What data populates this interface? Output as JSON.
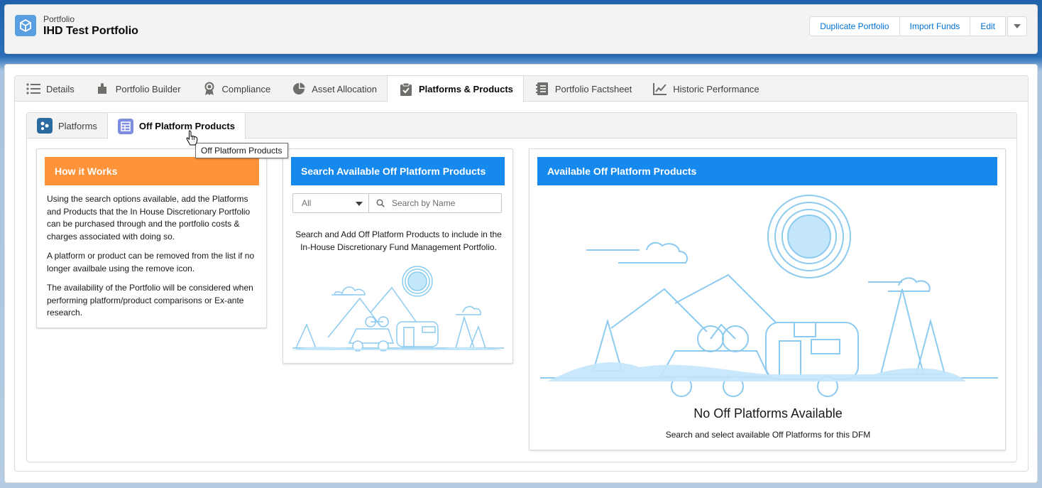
{
  "header": {
    "eyebrow": "Portfolio",
    "title": "IHD Test Portfolio",
    "buttons": [
      "Duplicate Portfolio",
      "Import Funds",
      "Edit"
    ]
  },
  "tabs": [
    {
      "label": "Details",
      "icon": "list-icon"
    },
    {
      "label": "Portfolio Builder",
      "icon": "puzzle-icon"
    },
    {
      "label": "Compliance",
      "icon": "ribbon-icon"
    },
    {
      "label": "Asset Allocation",
      "icon": "pie-chart-icon"
    },
    {
      "label": "Platforms & Products",
      "icon": "clipboard-check-icon"
    },
    {
      "label": "Portfolio Factsheet",
      "icon": "notebook-icon"
    },
    {
      "label": "Historic Performance",
      "icon": "line-chart-icon"
    }
  ],
  "active_tab": "Platforms & Products",
  "subtabs": [
    {
      "label": "Platforms",
      "icon": "platforms-icon"
    },
    {
      "label": "Off Platform Products",
      "icon": "table-icon"
    }
  ],
  "active_subtab": "Off Platform Products",
  "tooltip": "Off Platform Products",
  "how_it_works": {
    "title": "How it Works",
    "paragraphs": [
      "Using the search options available, add the Platforms and Products that the In House Discretionary Portfolio can be purchased through and the portfolio costs & charges associated with doing so.",
      "A platform or product can be removed from the list if no longer availbale using the remove icon.",
      "The availability of the Portfolio will be considered when performing platform/product comparisons or Ex-ante research."
    ],
    "color": "#fe9339"
  },
  "search": {
    "title": "Search Available Off Platform Products",
    "filter_value": "All",
    "placeholder": "Search by Name",
    "hint": "Search and Add Off Platform Products to include in the In-House Discretionary Fund Management Portfolio.",
    "color": "#1589ee"
  },
  "available": {
    "title": "Available Off Platform Products",
    "empty_title": "No Off Platforms Available",
    "empty_subtitle": "Search and select available Off Platforms for this DFM",
    "color": "#1589ee"
  }
}
